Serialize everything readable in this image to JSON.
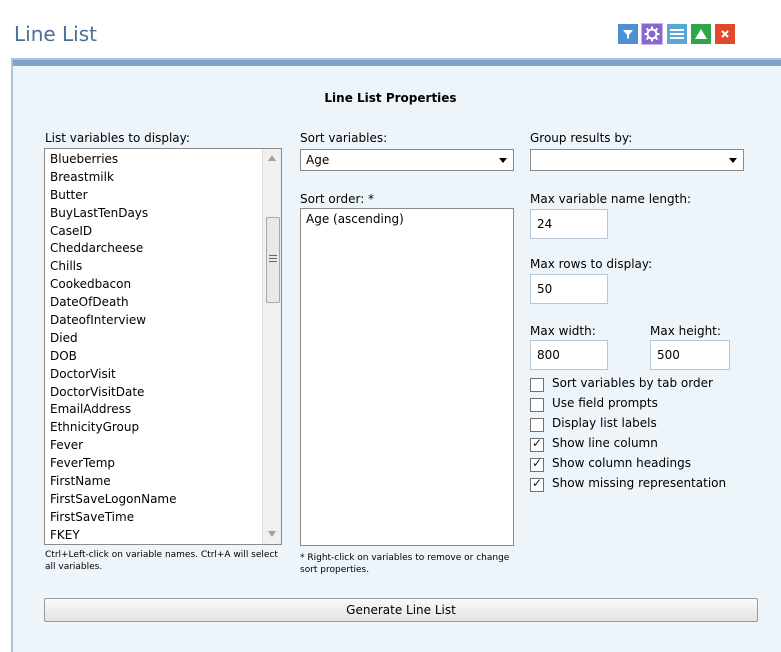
{
  "window": {
    "title": "Line List",
    "title_color": "#4d6e99",
    "toolbar_icons": [
      {
        "name": "filter-icon",
        "color": "#4f8fd6"
      },
      {
        "name": "gear-icon",
        "color": "#8a66d0"
      },
      {
        "name": "list-icon",
        "color": "#58a8d6"
      },
      {
        "name": "maximize-icon",
        "color": "#2fa64a"
      },
      {
        "name": "close-icon",
        "color": "#e04a2a"
      }
    ]
  },
  "properties": {
    "heading": "Line List Properties",
    "list_variables_label": "List variables to display:",
    "variables": [
      "Blueberries",
      "Breastmilk",
      "Butter",
      "BuyLastTenDays",
      "CaseID",
      "Cheddarcheese",
      "Chills",
      "Cookedbacon",
      "DateOfDeath",
      "DateofInterview",
      "Died",
      "DOB",
      "DoctorVisit",
      "DoctorVisitDate",
      "EmailAddress",
      "EthnicityGroup",
      "Fever",
      "FeverTemp",
      "FirstName",
      "FirstSaveLogonName",
      "FirstSaveTime",
      "FKEY"
    ],
    "variables_hint": "Ctrl+Left-click on variable names. Ctrl+A will select all variables.",
    "sort_variables_label": "Sort variables:",
    "sort_variables_value": "Age",
    "sort_order_label": "Sort order: *",
    "sort_order_items": [
      "Age (ascending)"
    ],
    "sort_hint": "* Right-click on variables to remove or change sort properties.",
    "group_by_label": "Group results by:",
    "group_by_value": "",
    "max_name_length_label": "Max variable name length:",
    "max_name_length_value": "24",
    "max_rows_label": "Max rows to display:",
    "max_rows_value": "50",
    "max_width_label": "Max width:",
    "max_width_value": "800",
    "max_height_label": "Max height:",
    "max_height_value": "500",
    "options": [
      {
        "label": "Sort variables by tab order",
        "checked": false
      },
      {
        "label": "Use field prompts",
        "checked": false
      },
      {
        "label": "Display list labels",
        "checked": false
      },
      {
        "label": "Show line column",
        "checked": true
      },
      {
        "label": "Show column headings",
        "checked": true
      },
      {
        "label": "Show missing representation",
        "checked": true
      }
    ],
    "generate_button": "Generate Line List"
  }
}
